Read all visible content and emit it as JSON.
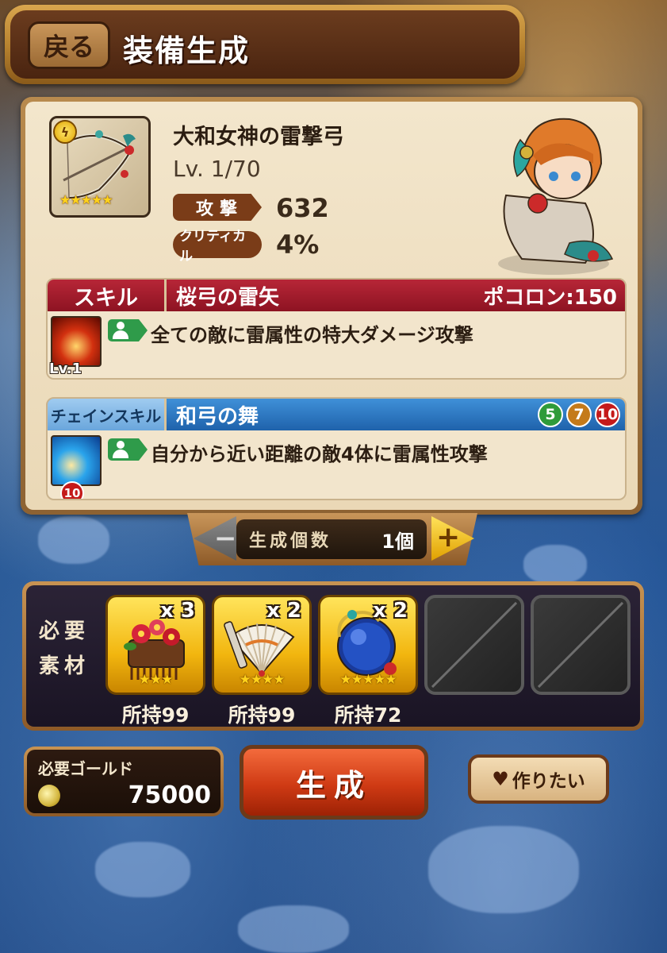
{
  "header": {
    "back_label": "戻る",
    "title": "装備生成"
  },
  "weapon": {
    "name": "大和女神の雷撃弓",
    "level": "Lv. 1/70",
    "rarity_stars": "★★★★★",
    "attack_label": "攻撃",
    "attack_value": "632",
    "crit_label": "クリティカル",
    "crit_value": "4%"
  },
  "skill": {
    "label": "スキル",
    "name": "桜弓の雷矢",
    "cost": "ポコロン:150",
    "description": "全ての敵に雷属性の特大ダメージ攻撃",
    "level": "Lv.1"
  },
  "chain_skill": {
    "label": "チェインスキル",
    "name": "和弓の舞",
    "chain_counts": [
      "5",
      "7",
      "10"
    ],
    "description": "自分から近い距離の敵4体に雷属性攻撃",
    "level_badge": "10"
  },
  "quantity": {
    "label": "生成個数",
    "value": "1個",
    "minus": "−",
    "plus": "+"
  },
  "materials": {
    "title": "必要素材",
    "items": [
      {
        "count": "x 3",
        "stars": "★★★",
        "owned": "所持99"
      },
      {
        "count": "x 2",
        "stars": "★★★★",
        "owned": "所持99"
      },
      {
        "count": "x 2",
        "stars": "★★★★★",
        "owned": "所持72"
      }
    ]
  },
  "gold": {
    "label": "必要ゴールド",
    "value": "75000"
  },
  "create_button": "生成",
  "wish_button": "作りたい",
  "colors": {
    "skill_red": "#b72637",
    "chain_blue": "#3f90d8",
    "create_orange": "#cf3a14",
    "gold_frame": "#f2b60f"
  }
}
